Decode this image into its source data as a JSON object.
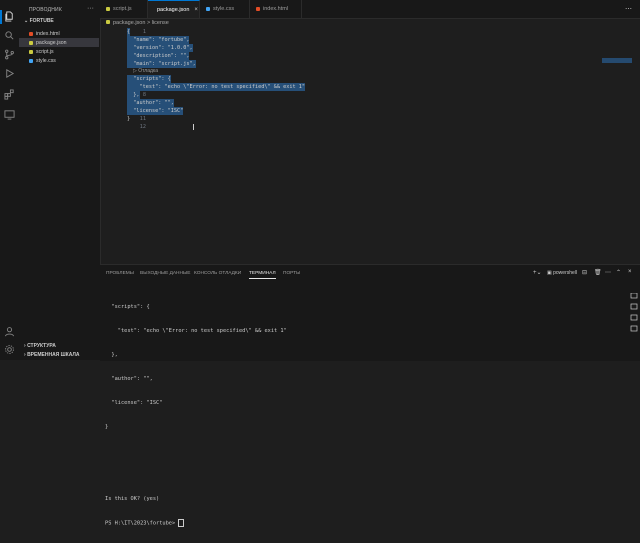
{
  "sidebar": {
    "title": "ПРОВОДНИК",
    "more": "···",
    "folder": "FORTUBE",
    "files": [
      {
        "name": "index.html",
        "color": "#e44d26"
      },
      {
        "name": "package.json",
        "color": "#cbcb41"
      },
      {
        "name": "script.js",
        "color": "#cbcb41"
      },
      {
        "name": "style.css",
        "color": "#42a5f5"
      }
    ],
    "outline": "СТРУКТУРА",
    "timeline": "ВРЕМЕННАЯ ШКАЛА"
  },
  "tabs": [
    {
      "label": "script.js",
      "close": "",
      "color": "#cbcb41"
    },
    {
      "label": "package.json",
      "close": "×",
      "color": "#cbcb41"
    },
    {
      "label": "style.css",
      "close": "",
      "color": "#42a5f5"
    },
    {
      "label": "index.html",
      "close": "",
      "color": "#e44d26"
    }
  ],
  "tab_actions": "⋯",
  "breadcrumb": {
    "file": "package.json",
    "sep": ">",
    "item": "license"
  },
  "debug_lens": "▷ Отладка",
  "lines": [
    {
      "n": "1",
      "text": "{"
    },
    {
      "n": "2",
      "text": "  \"name\": \"fortube\","
    },
    {
      "n": "3",
      "text": "  \"version\": \"1.0.0\","
    },
    {
      "n": "4",
      "text": "  \"description\": \"\","
    },
    {
      "n": "5",
      "text": "  \"main\": \"script.js\","
    },
    {
      "n": "6",
      "text": "  \"scripts\": {"
    },
    {
      "n": "7",
      "text": "    \"test\": \"echo \\\"Error: no test specified\\\" && exit 1\""
    },
    {
      "n": "8",
      "text": "  },"
    },
    {
      "n": "9",
      "text": "  \"author\": \"\","
    },
    {
      "n": "10",
      "text": "  \"license\": \"ISC\""
    },
    {
      "n": "11",
      "text": "}"
    },
    {
      "n": "12",
      "text": ""
    }
  ],
  "panel": {
    "tabs": [
      "ПРОБЛЕМЫ",
      "ВЫХОДНЫЕ ДАННЫЕ",
      "КОНСОЛЬ ОТЛАДКИ",
      "ТЕРМИНАЛ",
      "ПОРТЫ"
    ],
    "active_tab": 3,
    "shell": "powershell",
    "terminal_lines": [
      "  \"scripts\": {",
      "    \"test\": \"echo \\\"Error: no test specified\\\" && exit 1\"",
      "  },",
      "  \"author\": \"\",",
      "  \"license\": \"ISC\"",
      "}",
      "",
      "",
      "Is this OK? (yes)",
      "PS H:\\IT\\2023\\fortube> "
    ]
  }
}
